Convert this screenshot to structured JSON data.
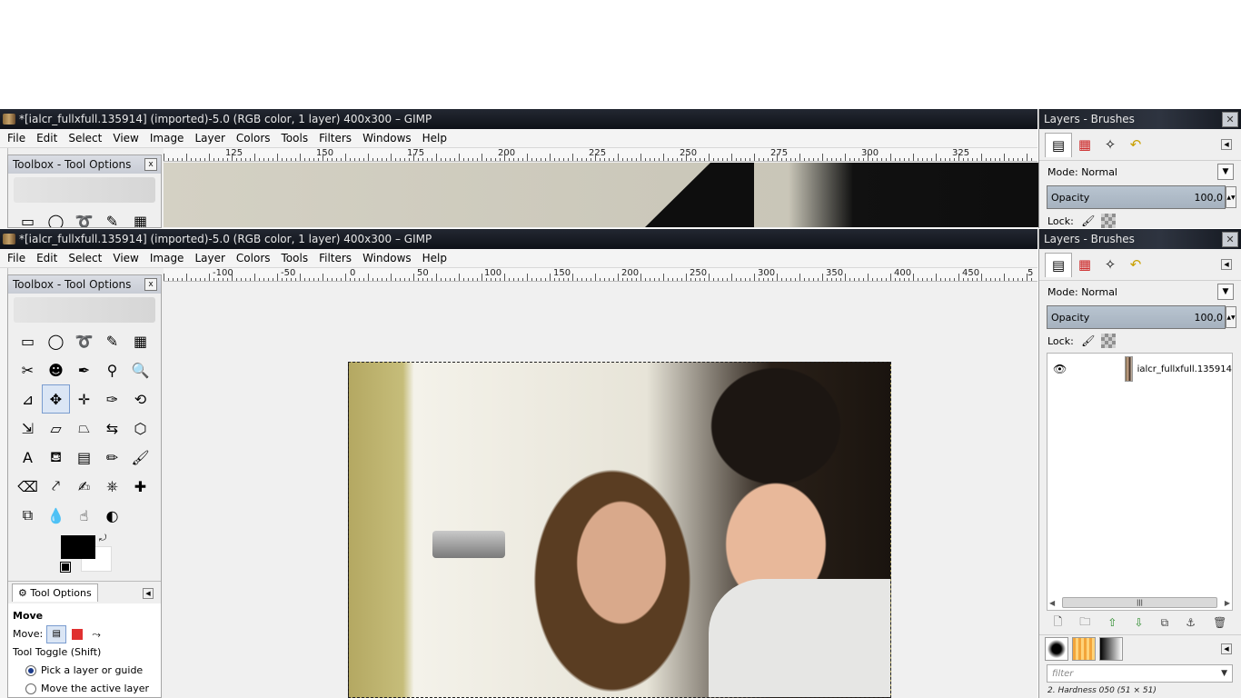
{
  "window_top": {
    "title": "*[ialcr_fullxfull.135914] (imported)-5.0 (RGB color, 1 layer) 400x300 – GIMP",
    "menu": [
      "File",
      "Edit",
      "Select",
      "View",
      "Image",
      "Layer",
      "Colors",
      "Tools",
      "Filters",
      "Windows",
      "Help"
    ],
    "ruler_labels": [
      "125",
      "150",
      "175",
      "200",
      "225",
      "250",
      "275",
      "300",
      "325"
    ]
  },
  "window_main": {
    "title": "*[ialcr_fullxfull.135914] (imported)-5.0 (RGB color, 1 layer) 400x300 – GIMP",
    "menu": [
      "File",
      "Edit",
      "Select",
      "View",
      "Image",
      "Layer",
      "Colors",
      "Tools",
      "Filters",
      "Windows",
      "Help"
    ],
    "ruler_labels": [
      "-100",
      "-50",
      "0",
      "50",
      "100",
      "150",
      "200",
      "250",
      "300",
      "350",
      "400",
      "450",
      "5"
    ]
  },
  "toolbox": {
    "title": "Toolbox - Tool Options",
    "close": "x",
    "tools": [
      {
        "name": "rect-select-icon",
        "glyph": "▭"
      },
      {
        "name": "ellipse-select-icon",
        "glyph": "◯"
      },
      {
        "name": "free-select-icon",
        "glyph": "➰"
      },
      {
        "name": "fuzzy-select-icon",
        "glyph": "✎"
      },
      {
        "name": "select-by-color-icon",
        "glyph": "▦"
      },
      {
        "name": "scissors-icon",
        "glyph": "✂"
      },
      {
        "name": "foreground-select-icon",
        "glyph": "☻"
      },
      {
        "name": "paths-icon",
        "glyph": "✒"
      },
      {
        "name": "color-picker-icon",
        "glyph": "⚲"
      },
      {
        "name": "zoom-icon",
        "glyph": "🔍"
      },
      {
        "name": "measure-icon",
        "glyph": "⊿"
      },
      {
        "name": "move-icon",
        "glyph": "✥"
      },
      {
        "name": "align-icon",
        "glyph": "✛"
      },
      {
        "name": "crop-icon",
        "glyph": "✑"
      },
      {
        "name": "rotate-icon",
        "glyph": "⟲"
      },
      {
        "name": "scale-icon",
        "glyph": "⇲"
      },
      {
        "name": "shear-icon",
        "glyph": "▱"
      },
      {
        "name": "perspective-icon",
        "glyph": "⏢"
      },
      {
        "name": "flip-icon",
        "glyph": "⇆"
      },
      {
        "name": "cage-icon",
        "glyph": "⬡"
      },
      {
        "name": "text-icon",
        "glyph": "A"
      },
      {
        "name": "bucket-fill-icon",
        "glyph": "⛾"
      },
      {
        "name": "blend-icon",
        "glyph": "▤"
      },
      {
        "name": "pencil-icon",
        "glyph": "✏"
      },
      {
        "name": "paintbrush-icon",
        "glyph": "🖌"
      },
      {
        "name": "eraser-icon",
        "glyph": "⌫"
      },
      {
        "name": "airbrush-icon",
        "glyph": "⤤"
      },
      {
        "name": "ink-icon",
        "glyph": "✍"
      },
      {
        "name": "clone-icon",
        "glyph": "⎈"
      },
      {
        "name": "heal-icon",
        "glyph": "✚"
      },
      {
        "name": "perspective-clone-icon",
        "glyph": "⧉"
      },
      {
        "name": "blur-icon",
        "glyph": "💧"
      },
      {
        "name": "smudge-icon",
        "glyph": "☝"
      },
      {
        "name": "dodge-burn-icon",
        "glyph": "◐"
      }
    ],
    "fg_color": "#000000",
    "bg_color": "#ffffff",
    "options_tab": "Tool Options",
    "tool_name": "Move",
    "move_label": "Move:",
    "toggle_label": "Tool Toggle  (Shift)",
    "radio1": "Pick a layer or guide",
    "radio2": "Move the active layer"
  },
  "toolbox_top": {
    "title": "Toolbox - Tool Options",
    "close": "x"
  },
  "dock_top": {
    "title": "Layers - Brushes",
    "mode_label": "Mode:",
    "mode_value": "Normal",
    "opacity_label": "Opacity",
    "opacity_value": "100,0",
    "lock_label": "Lock:"
  },
  "dock_main": {
    "title": "Layers - Brushes",
    "mode_label": "Mode:",
    "mode_value": "Normal",
    "opacity_label": "Opacity",
    "opacity_value": "100,0",
    "lock_label": "Lock:",
    "layer_name": "ialcr_fullxfull.135914",
    "filter_placeholder": "filter",
    "brush_name": "2. Hardness 050 (51 × 51)"
  }
}
